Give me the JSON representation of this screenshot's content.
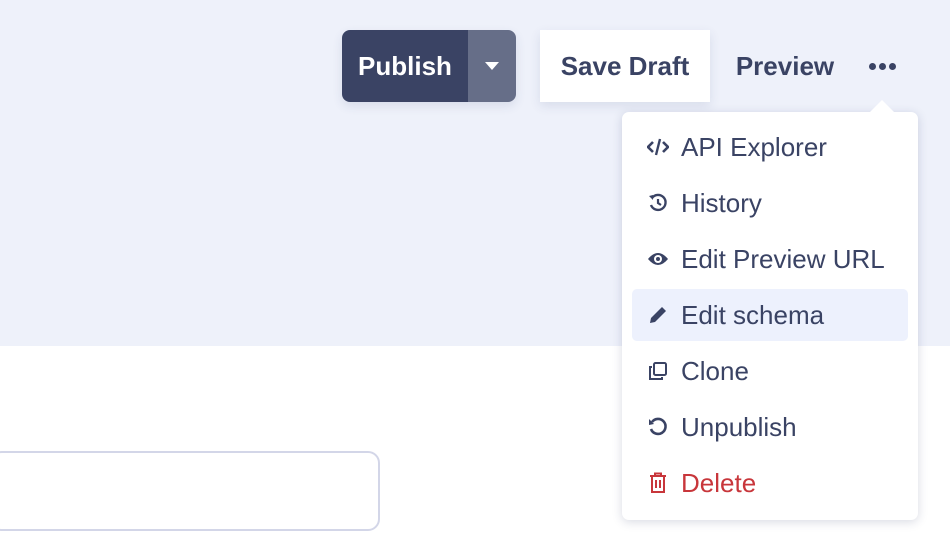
{
  "toolbar": {
    "publish_label": "Publish",
    "save_draft_label": "Save Draft",
    "preview_label": "Preview",
    "more_icon": "ellipsis-icon"
  },
  "menu": {
    "items": [
      {
        "label": "API Explorer",
        "icon": "code-icon"
      },
      {
        "label": "History",
        "icon": "history-icon"
      },
      {
        "label": "Edit Preview URL",
        "icon": "eye-icon"
      },
      {
        "label": "Edit schema",
        "icon": "pencil-icon",
        "highlighted": true
      },
      {
        "label": "Clone",
        "icon": "clone-icon"
      },
      {
        "label": "Unpublish",
        "icon": "undo-icon"
      },
      {
        "label": "Delete",
        "icon": "trash-icon",
        "danger": true
      }
    ]
  },
  "colors": {
    "primary": "#3a4364",
    "danger": "#c8363b",
    "highlight": "#edf1fd",
    "background": "#eef1fa"
  }
}
